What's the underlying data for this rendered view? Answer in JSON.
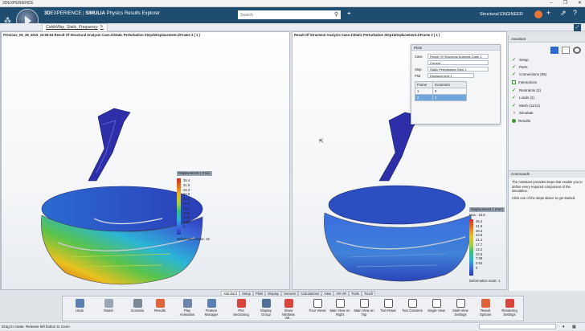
{
  "window": {
    "title": "3DEXPERIENCE",
    "controls": [
      "–",
      "❐",
      "✕"
    ]
  },
  "topbar": {
    "brand_bold": "3D",
    "brand_rest": "EXPERIENCE",
    "brand_sep": " | ",
    "brand_app": "SIMULIA",
    "brand_sub": " Physics Results Explorer",
    "search_placeholder": "Search",
    "user": "Structural ENGINEER"
  },
  "document": {
    "tab": "CobleWay_Static_Frequency",
    "close": "✕",
    "add": "+"
  },
  "left_viewport": {
    "title": "Previous_05_28_2019_15:09:04 Result Of Structural Analysis Case.1\\Static Perturbation Step1\\Displacement.1\\Frame 2 ( 1 )",
    "legend_title": "Displacement.1 (mm)",
    "legend_values": [
      "35.4",
      "31.8",
      "28.3",
      "24.8",
      "21.2",
      "17.7",
      "14.1",
      "10.6",
      "7.07",
      "3.54",
      "0"
    ],
    "deformation": "Deformation scale: 16"
  },
  "right_viewport": {
    "title": "Result Of Structural Analysis Case.1\\Static Perturbation Step1\\Displacement.1\\Frame 2 ( 1 )",
    "legend_title": "Displacement.1 (mm)",
    "legend_max": "Max : 18.8",
    "legend_values": [
      "35.4",
      "31.9",
      "28.3",
      "24.8",
      "21.2",
      "17.7",
      "14.2",
      "10.6",
      "7.08",
      "3.54",
      "0"
    ],
    "deformation": "Deformation scale: 1"
  },
  "plots_panel": {
    "title": "Plots",
    "case_label": "Case",
    "case_value": "Result Of Structural Analysis Case.1",
    "case_sub": "Current",
    "step_label": "Step",
    "step_value": "Static Perturbation Step 1",
    "plot_label": "Plot",
    "plot_value": "Displacement.1",
    "table_headers": [
      "Frame",
      "Increment"
    ],
    "rows": [
      [
        "1",
        "0"
      ],
      [
        "2",
        "1"
      ]
    ]
  },
  "assistant": {
    "title": "Assistant",
    "items": [
      "Setup",
      "Parts",
      "Connections (55)",
      "Interactions",
      "Restraints (2)",
      "Loads (2)",
      "Mesh (11/11)",
      "Simulate",
      "Results"
    ],
    "commands_title": "Commands",
    "commands_text": "The Assistant provides steps that enable you to define every required component of the simulation.",
    "commands_text2": "Click one of the steps above to get started."
  },
  "action_tabs": [
    "Standard",
    "Setup",
    "Plots",
    "Display",
    "Sensors",
    "Calculations",
    "View",
    "AR-VR",
    "Tools",
    "Touch"
  ],
  "tools": [
    {
      "label": "Undo"
    },
    {
      "label": "Model"
    },
    {
      "label": "Scenario"
    },
    {
      "label": "Results"
    },
    {
      "label": "Play Animation"
    },
    {
      "label": "Feature Manager"
    },
    {
      "label": "Plot Sectioning"
    },
    {
      "label": "Display Group"
    },
    {
      "label": "Show Min/Max Val..."
    },
    {
      "label": "Four Views"
    },
    {
      "label": "Main View on Right"
    },
    {
      "label": "Main View on Top"
    },
    {
      "label": "Two Rows"
    },
    {
      "label": "Two Columns"
    },
    {
      "label": "Single View"
    },
    {
      "label": "Multi-View Settings"
    },
    {
      "label": "Result Options"
    },
    {
      "label": "Rendering Settings"
    }
  ],
  "status": {
    "text": "Drag to rotate. Release left button to zoom"
  },
  "colors": {
    "topbar": "#1f4d6f",
    "accent": "#e8743b",
    "check": "#3a9a2a",
    "warn": "#d11a1a"
  }
}
